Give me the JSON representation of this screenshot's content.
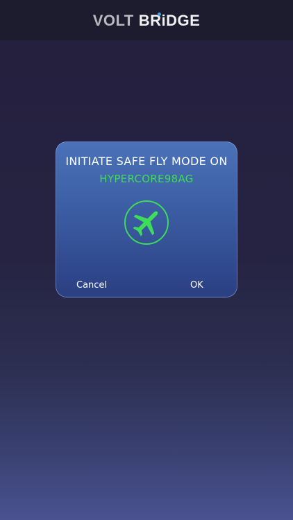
{
  "header": {
    "logo_part1": "VOLT",
    "logo_part2": "BRiDGE"
  },
  "dialog": {
    "title": "INITIATE SAFE FLY MODE ON",
    "device_name": "HYPERCORE98AG",
    "icon": "airplane-icon",
    "cancel_label": "Cancel",
    "ok_label": "OK"
  },
  "colors": {
    "accent_green": "#3ddc5a",
    "logo_dot": "#3aa0e6"
  }
}
